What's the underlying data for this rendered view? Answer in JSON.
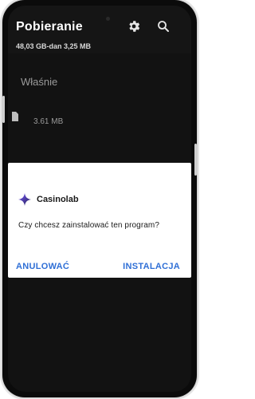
{
  "app_bar": {
    "title": "Pobieranie",
    "storage_summary": "48,03 GB-dan 3,25 MB",
    "icons": [
      "settings-icon",
      "search-icon"
    ]
  },
  "list": {
    "section_header": "Właśnie",
    "items": [
      {
        "icon": "document-icon",
        "size": "3.61 MB"
      }
    ]
  },
  "dialog": {
    "app_icon": "sparkle-app-icon",
    "app_name": "Casinolab",
    "message": "Czy chcesz zainstalować ten program?",
    "cancel_label": "ANULOWAĆ",
    "install_label": "INSTALACJA"
  },
  "colors": {
    "screen_bg": "#121212",
    "dialog_bg": "#ffffff",
    "action_blue": "#2f6fd6"
  }
}
